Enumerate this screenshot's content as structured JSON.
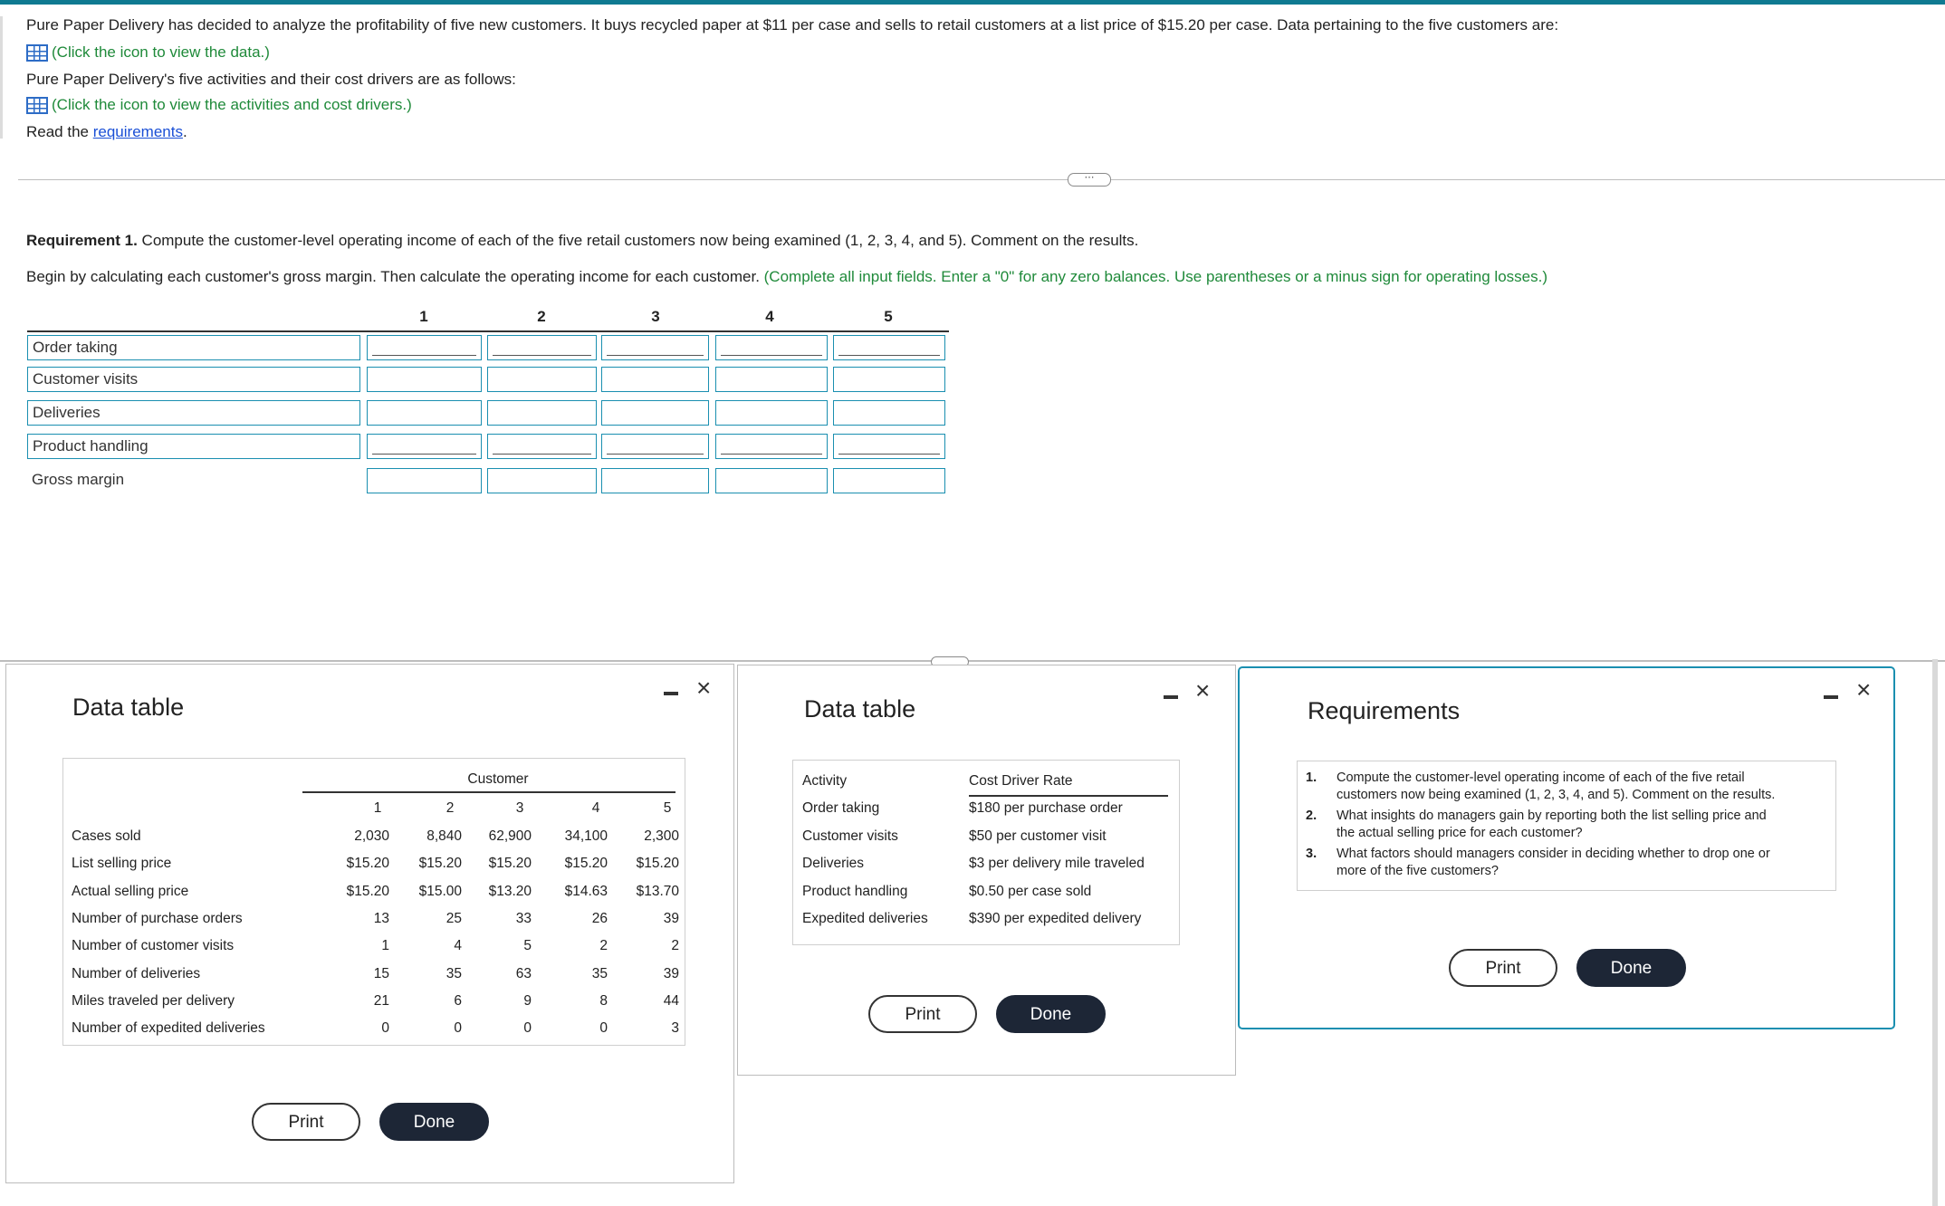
{
  "intro": {
    "line1": "Pure Paper Delivery has decided to analyze the profitability of five new customers. It buys recycled paper at $11 per case and sells to retail customers at a list price of $15.20 per case. Data pertaining to the five customers are:",
    "data_link": "(Click the icon to view the data.)",
    "line2": "Pure Paper Delivery's five activities and their cost drivers are as follows:",
    "activities_link": "(Click the icon to view the activities and cost drivers.)",
    "read_prefix": "Read the ",
    "requirements_link": "requirements",
    "read_suffix": "."
  },
  "requirement1": {
    "label": "Requirement 1.",
    "text": " Compute the customer-level operating income of each of the five retail customers now being examined (1, 2, 3, 4, and 5). Comment on the results.",
    "begin": "Begin by calculating each customer's gross margin. Then calculate the operating income for each customer.",
    "instructions": " (Complete all input fields. Enter a \"0\" for any zero balances. Use parentheses or a minus sign for operating losses.)"
  },
  "worksheet": {
    "columns": [
      "1",
      "2",
      "3",
      "4",
      "5"
    ],
    "rows": [
      "Order taking",
      "Customer visits",
      "Deliveries",
      "Product handling",
      "Gross margin"
    ]
  },
  "data_modal": {
    "title": "Data table",
    "customer_header": "Customer",
    "columns": [
      "1",
      "2",
      "3",
      "4",
      "5"
    ],
    "rows": [
      {
        "label": "Cases sold",
        "values": [
          "2,030",
          "8,840",
          "62,900",
          "34,100",
          "2,300"
        ]
      },
      {
        "label": "List selling price",
        "values": [
          "$15.20",
          "$15.20",
          "$15.20",
          "$15.20",
          "$15.20"
        ]
      },
      {
        "label": "Actual selling price",
        "values": [
          "$15.20",
          "$15.00",
          "$13.20",
          "$14.63",
          "$13.70"
        ]
      },
      {
        "label": "Number of purchase orders",
        "values": [
          "13",
          "25",
          "33",
          "26",
          "39"
        ]
      },
      {
        "label": "Number of customer visits",
        "values": [
          "1",
          "4",
          "5",
          "2",
          "2"
        ]
      },
      {
        "label": "Number of deliveries",
        "values": [
          "15",
          "35",
          "63",
          "35",
          "39"
        ]
      },
      {
        "label": "Miles traveled per delivery",
        "values": [
          "21",
          "6",
          "9",
          "8",
          "44"
        ]
      },
      {
        "label": "Number of expedited deliveries",
        "values": [
          "0",
          "0",
          "0",
          "0",
          "3"
        ]
      }
    ],
    "print": "Print",
    "done": "Done"
  },
  "activity_modal": {
    "title": "Data table",
    "head_activity": "Activity",
    "head_rate": "Cost Driver Rate",
    "rows": [
      {
        "activity": "Order taking",
        "rate": "$180 per purchase order"
      },
      {
        "activity": "Customer visits",
        "rate": "$50 per customer visit"
      },
      {
        "activity": "Deliveries",
        "rate": "$3 per delivery mile traveled"
      },
      {
        "activity": "Product handling",
        "rate": "$0.50 per case sold"
      },
      {
        "activity": "Expedited deliveries",
        "rate": "$390 per expedited delivery"
      }
    ],
    "print": "Print",
    "done": "Done"
  },
  "requirements_modal": {
    "title": "Requirements",
    "items": [
      {
        "num": "1.",
        "l1": "Compute the customer-level operating income of each of the five retail",
        "l2": "customers now being examined (1, 2, 3, 4, and 5). Comment on the results."
      },
      {
        "num": "2.",
        "l1": "What insights do managers gain by reporting both the list selling price and",
        "l2": "the actual selling price for each customer?"
      },
      {
        "num": "3.",
        "l1": "What factors should managers consider in deciding whether to drop one or",
        "l2": "more of the five customers?"
      }
    ],
    "print": "Print",
    "done": "Done"
  },
  "icons": {
    "close": "×",
    "dots": "⋯"
  }
}
